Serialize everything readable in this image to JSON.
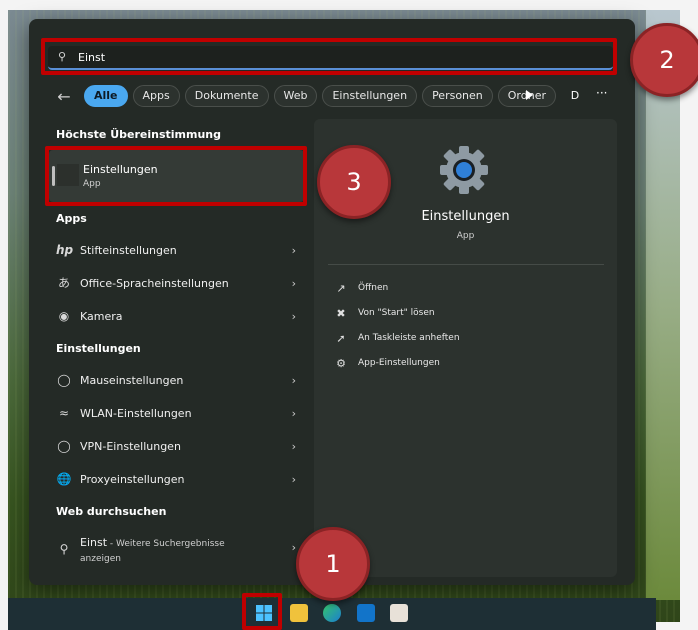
{
  "search": {
    "value": "Einst",
    "icon": "search-icon"
  },
  "filters": [
    "Alle",
    "Apps",
    "Dokumente",
    "Web",
    "Einstellungen",
    "Personen",
    "Ordner"
  ],
  "avatar_initial": "D",
  "more_label": "···",
  "best_match": {
    "heading": "Höchste Übereinstimmung",
    "title": "Einstellungen",
    "subtitle": "App"
  },
  "apps": {
    "heading": "Apps",
    "items": [
      {
        "label": "Stifteinstellungen",
        "icon": "hp-icon"
      },
      {
        "label": "Office-Spracheinstellungen",
        "icon": "language-icon"
      },
      {
        "label": "Kamera",
        "icon": "camera-icon"
      }
    ]
  },
  "settings": {
    "heading": "Einstellungen",
    "items": [
      {
        "label": "Mauseinstellungen",
        "icon": "mouse-icon"
      },
      {
        "label": "WLAN-Einstellungen",
        "icon": "wifi-icon"
      },
      {
        "label": "VPN-Einstellungen",
        "icon": "shield-icon"
      },
      {
        "label": "Proxyeinstellungen",
        "icon": "globe-icon"
      }
    ]
  },
  "web": {
    "heading": "Web durchsuchen",
    "query": "Einst",
    "suffix": " - Weitere Suchergebnisse",
    "suffix2": "anzeigen"
  },
  "detail": {
    "title": "Einstellungen",
    "subtitle": "App",
    "actions": [
      {
        "label": "Öffnen",
        "icon": "open-icon"
      },
      {
        "label": "Von \"Start\" lösen",
        "icon": "unpin-icon"
      },
      {
        "label": "An Taskleiste anheften",
        "icon": "pin-icon"
      },
      {
        "label": "App-Einstellungen",
        "icon": "gear-icon"
      }
    ]
  },
  "badges": [
    "1",
    "2",
    "3"
  ],
  "colors": {
    "accent": "#4aa8f0",
    "highlight": "#c00000",
    "badge": "#b8373a"
  }
}
